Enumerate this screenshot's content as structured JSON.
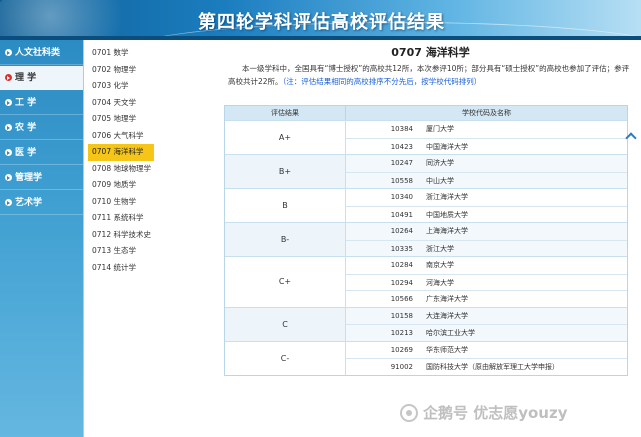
{
  "header": {
    "title": "第四轮学科评估高校评估结果"
  },
  "sidebar": {
    "items": [
      {
        "label": "人文社科类",
        "active": false
      },
      {
        "label": "理 学",
        "active": true
      },
      {
        "label": "工 学",
        "active": false
      },
      {
        "label": "农 学",
        "active": false
      },
      {
        "label": "医 学",
        "active": false
      },
      {
        "label": "管理学",
        "active": false
      },
      {
        "label": "艺术学",
        "active": false
      }
    ]
  },
  "subjects": [
    "0701 数学",
    "0702 物理学",
    "0703 化学",
    "0704 天文学",
    "0705 地理学",
    "0706 大气科学",
    "0707 海洋科学",
    "0708 地球物理学",
    "0709 地质学",
    "0710 生物学",
    "0711 系统科学",
    "0712 科学技术史",
    "0713 生态学",
    "0714 统计学"
  ],
  "active_subject": "0707 海洋科学",
  "main": {
    "title": "0707 海洋科学",
    "description": "本一级学科中，全国具有“博士授权”的高校共12所，本次参评10所；部分具有“硕士授权”的高校也参加了评估；参评高校共计22所。",
    "note": "（注：评估结果相同的高校排序不分先后，按学校代码排列）"
  },
  "table": {
    "headers": [
      "评估结果",
      "学校代码及名称"
    ],
    "groups": [
      {
        "grade": "A+",
        "rows": [
          {
            "code": "10384",
            "name": "厦门大学"
          },
          {
            "code": "10423",
            "name": "中国海洋大学"
          }
        ]
      },
      {
        "grade": "B+",
        "rows": [
          {
            "code": "10247",
            "name": "同济大学"
          },
          {
            "code": "10558",
            "name": "中山大学"
          }
        ]
      },
      {
        "grade": "B",
        "rows": [
          {
            "code": "10340",
            "name": "浙江海洋大学"
          },
          {
            "code": "10491",
            "name": "中国地质大学"
          }
        ]
      },
      {
        "grade": "B-",
        "rows": [
          {
            "code": "10264",
            "name": "上海海洋大学"
          },
          {
            "code": "10335",
            "name": "浙江大学"
          }
        ]
      },
      {
        "grade": "C+",
        "rows": [
          {
            "code": "10284",
            "name": "南京大学"
          },
          {
            "code": "10294",
            "name": "河海大学"
          },
          {
            "code": "10566",
            "name": "广东海洋大学"
          }
        ]
      },
      {
        "grade": "C",
        "rows": [
          {
            "code": "10158",
            "name": "大连海洋大学"
          },
          {
            "code": "10213",
            "name": "哈尔滨工业大学"
          }
        ]
      },
      {
        "grade": "C-",
        "rows": [
          {
            "code": "10269",
            "name": "华东师范大学"
          },
          {
            "code": "91002",
            "name": "国防科技大学（原由解放军理工大学申报）"
          }
        ]
      }
    ]
  },
  "watermark": {
    "text": "企鹅号 优志愿youzy",
    "icon": "penguin-logo-icon"
  }
}
